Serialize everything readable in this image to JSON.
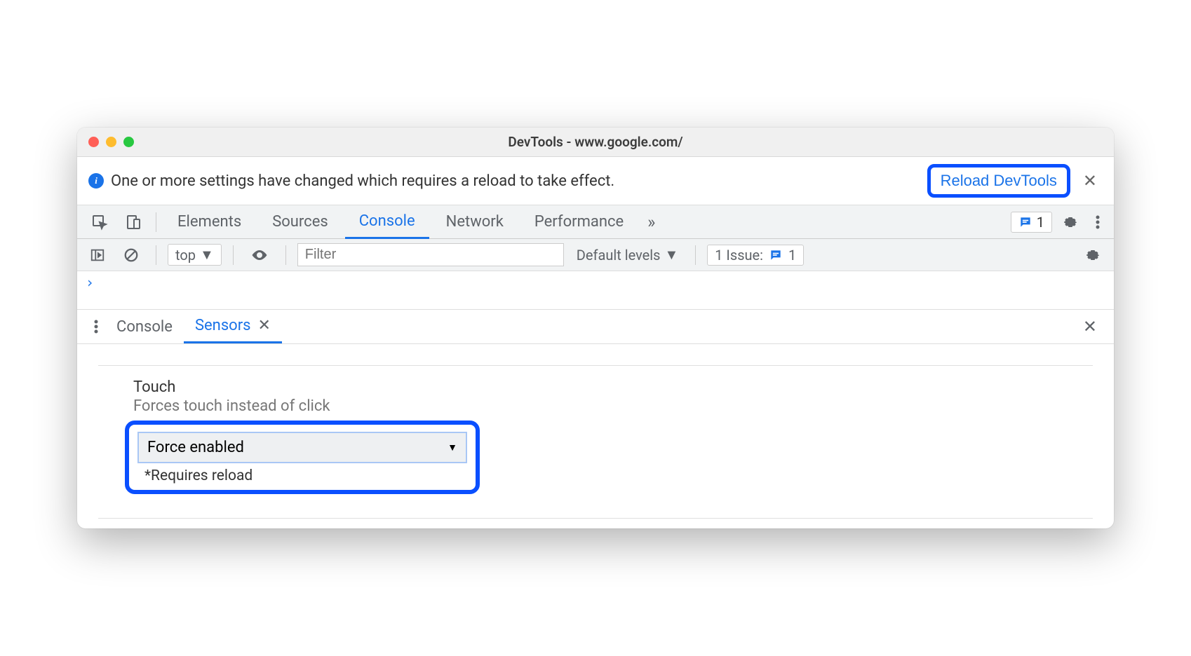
{
  "window": {
    "title": "DevTools - www.google.com/"
  },
  "infobar": {
    "message": "One or more settings have changed which requires a reload to take effect.",
    "button": "Reload DevTools"
  },
  "tabs": {
    "items": [
      "Elements",
      "Sources",
      "Console",
      "Network",
      "Performance"
    ],
    "active": "Console",
    "overflow": "»",
    "issues_count": "1"
  },
  "filterbar": {
    "context": "top",
    "filter_placeholder": "Filter",
    "levels": "Default levels",
    "issues_label": "1 Issue:",
    "issues_count": "1"
  },
  "console": {
    "prompt": "›"
  },
  "drawer": {
    "tabs": [
      "Console",
      "Sensors"
    ],
    "active": "Sensors"
  },
  "sensors": {
    "touch": {
      "title": "Touch",
      "subtitle": "Forces touch instead of click",
      "selected": "Force enabled",
      "note": "*Requires reload"
    }
  }
}
